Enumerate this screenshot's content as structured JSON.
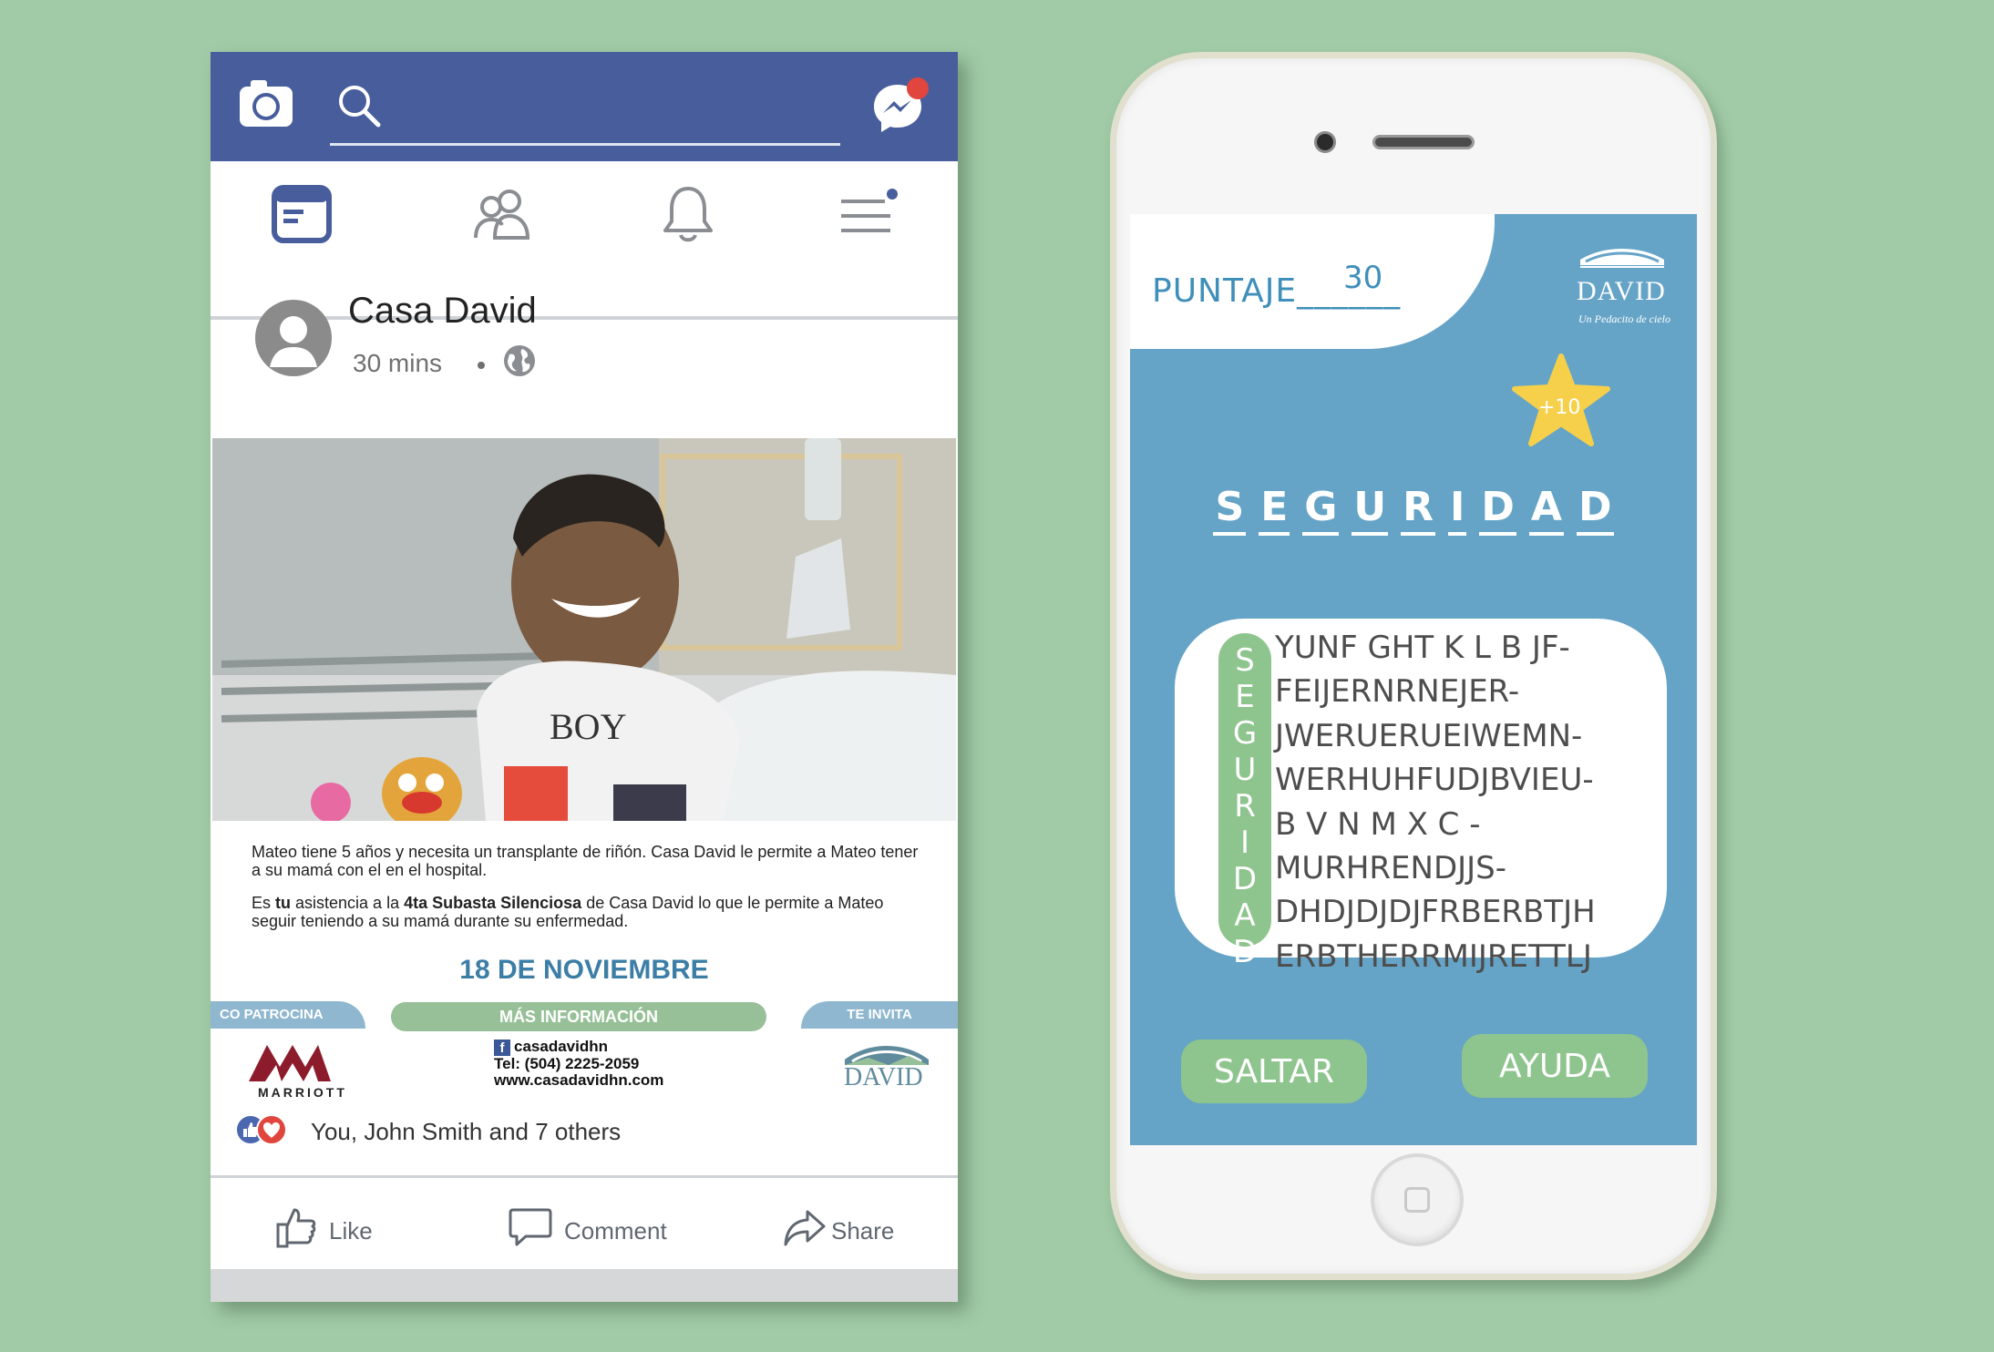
{
  "facebook": {
    "page_name": "Casa David",
    "post_time": "30 mins",
    "post_text": {
      "p1": "Mateo tiene 5 años y necesita un transplante de riñón. Casa David le permite a Mateo tener a su mamá con el en el hospital.",
      "p2_a": "Es ",
      "p2_b": "tu",
      "p2_c": " asistencia a la ",
      "p2_d": "4ta Subasta Silenciosa",
      "p2_e": " de Casa David lo que le permite a Mateo seguir teniendo a su mamá durante su enfermedad."
    },
    "event_date": "18 DE NOVIEMBRE",
    "tabs": {
      "sponsor": "CO PATROCINA",
      "info": "MÁS INFORMACIÓN",
      "invite": "TE INVITA"
    },
    "sponsor_name": "MARRIOTT",
    "contact": {
      "facebook_handle": "casadavidhn",
      "phone": "Tel: (504) 2225-2059",
      "website": "www.casadavidhn.com"
    },
    "logo_word": "CASA DAVID",
    "logo_tagline": "Un pedacito de cielo",
    "reactions_text": "You, John Smith and 7 others",
    "actions": {
      "like": "Like",
      "comment": "Comment",
      "share": "Share"
    },
    "colors": {
      "topbar": "#485d9b",
      "date": "#3d7ea6",
      "info_tab": "#97c098",
      "side_tabs": "#8fb7cf"
    }
  },
  "game": {
    "score_label": "PUNTAJE______",
    "score_value": "30",
    "brand_word": "DAVID",
    "brand_tag": "Un Pedacito de cielo",
    "bonus": "+10",
    "target_word_letters": [
      "S",
      "E",
      "G",
      "U",
      "R",
      "I",
      "D",
      "A",
      "D"
    ],
    "highlight_column": "S\nE\nG\nU\nR\nI\nD\nA\nD",
    "grid_rows": [
      "YUNF GHT K L B JF-",
      "FEIJERNRNEJER-",
      "JWERUERUEIWEMN-",
      "WERHUHFUDJBVIEU-",
      "B V N M X C -",
      "MURHRENDJJS-",
      "DHDJDJDJFRBERBTJH",
      "ERBTHERRMIJRETTLJ"
    ],
    "buttons": {
      "skip": "SALTAR",
      "help": "AYUDA"
    },
    "colors": {
      "screen": "#65a4c7",
      "accent_green": "#8ec48d",
      "score_text": "#3f8fbb",
      "star": "#f6d04a"
    }
  }
}
